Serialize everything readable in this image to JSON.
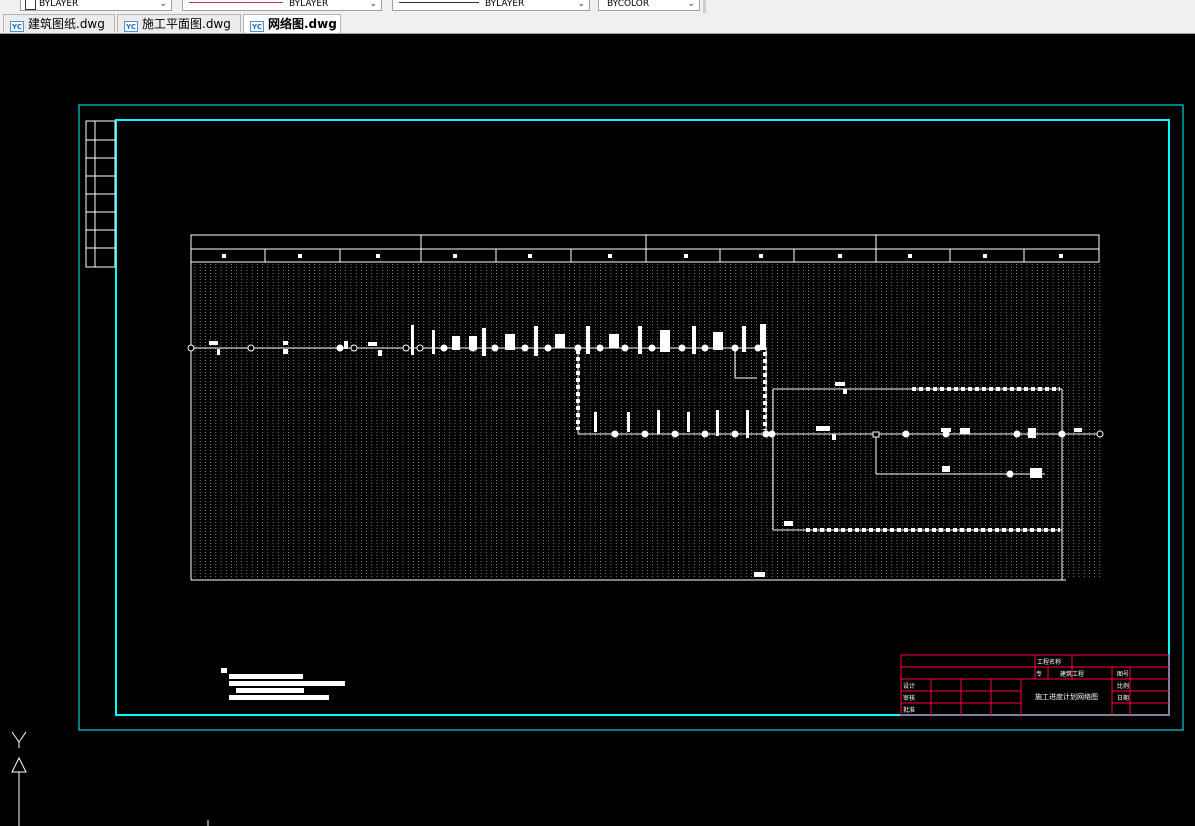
{
  "toolbar": {
    "layer_combo": "BYLAYER",
    "linetype_combo": "BYLAYER",
    "lineweight_combo": "BYLAYER",
    "color_combo": "BYCOLOR"
  },
  "tabs": [
    {
      "label": "建筑图纸.dwg",
      "icon": "yjk-file-icon",
      "active": false
    },
    {
      "label": "施工平面图.dwg",
      "icon": "yjk-file-icon",
      "active": false
    },
    {
      "label": "网络图.dwg",
      "icon": "yjk-file-icon",
      "active": true
    }
  ],
  "drawing": {
    "title_block": {
      "project_name_label": "工程名称",
      "drawing_title": "施工进度计划网络图",
      "specialty_label": "专",
      "specialty_value": "建筑工程",
      "drawing_no_label": "图号",
      "scale_label": "比例",
      "date_label": "日期",
      "design_label": "设计",
      "check_label": "审核",
      "approve_label": "批准"
    }
  },
  "colors": {
    "frame_cyan": "#00ffff",
    "title_block_red": "#ff0040",
    "drawing_white": "#ffffff",
    "background": "#000000"
  }
}
